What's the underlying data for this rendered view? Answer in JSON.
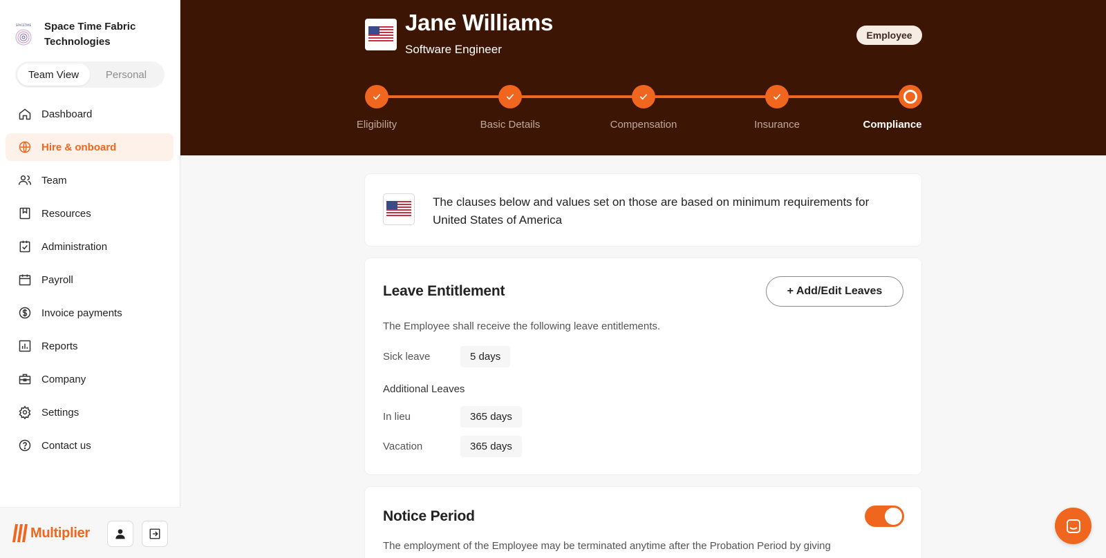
{
  "company": {
    "name": "Space Time Fabric Technologies",
    "logo_icon": "spacetime-logo"
  },
  "view_toggle": {
    "options": [
      "Team View",
      "Personal"
    ],
    "selected": "Team View"
  },
  "sidebar": {
    "items": [
      {
        "label": "Dashboard",
        "icon": "home-icon"
      },
      {
        "label": "Hire & onboard",
        "icon": "globe-icon",
        "active": true
      },
      {
        "label": "Team",
        "icon": "users-icon"
      },
      {
        "label": "Resources",
        "icon": "bookmark-icon"
      },
      {
        "label": "Administration",
        "icon": "clipboard-check-icon"
      },
      {
        "label": "Payroll",
        "icon": "calendar-icon"
      },
      {
        "label": "Invoice payments",
        "icon": "dollar-icon"
      },
      {
        "label": "Reports",
        "icon": "chart-icon"
      },
      {
        "label": "Company",
        "icon": "briefcase-icon"
      },
      {
        "label": "Settings",
        "icon": "gear-icon"
      },
      {
        "label": "Contact us",
        "icon": "help-icon"
      }
    ],
    "footer": {
      "brand": "Multiplier"
    }
  },
  "employee": {
    "name": "Jane Williams",
    "role": "Software Engineer",
    "type": "Employee",
    "country_flag": "us-flag-icon"
  },
  "stepper": {
    "steps": [
      {
        "label": "Eligibility",
        "status": "done"
      },
      {
        "label": "Basic Details",
        "status": "done"
      },
      {
        "label": "Compensation",
        "status": "done"
      },
      {
        "label": "Insurance",
        "status": "done"
      },
      {
        "label": "Compliance",
        "status": "current"
      }
    ]
  },
  "info": {
    "text": "The clauses below and values set on those are based on minimum requirements for United States of America"
  },
  "leave": {
    "title": "Leave Entitlement",
    "button": "+ Add/Edit Leaves",
    "description": "The Employee shall receive the following leave entitlements.",
    "sick": {
      "label": "Sick leave",
      "value": "5 days"
    },
    "additional_title": "Additional Leaves",
    "additional": [
      {
        "label": "In lieu",
        "value": "365 days"
      },
      {
        "label": "Vacation",
        "value": "365 days"
      }
    ]
  },
  "notice": {
    "title": "Notice Period",
    "enabled": true,
    "text": "The employment of the Employee may be terminated anytime after the Probation Period by giving"
  },
  "colors": {
    "accent": "#f0661e",
    "header_bg": "#3d1505"
  }
}
